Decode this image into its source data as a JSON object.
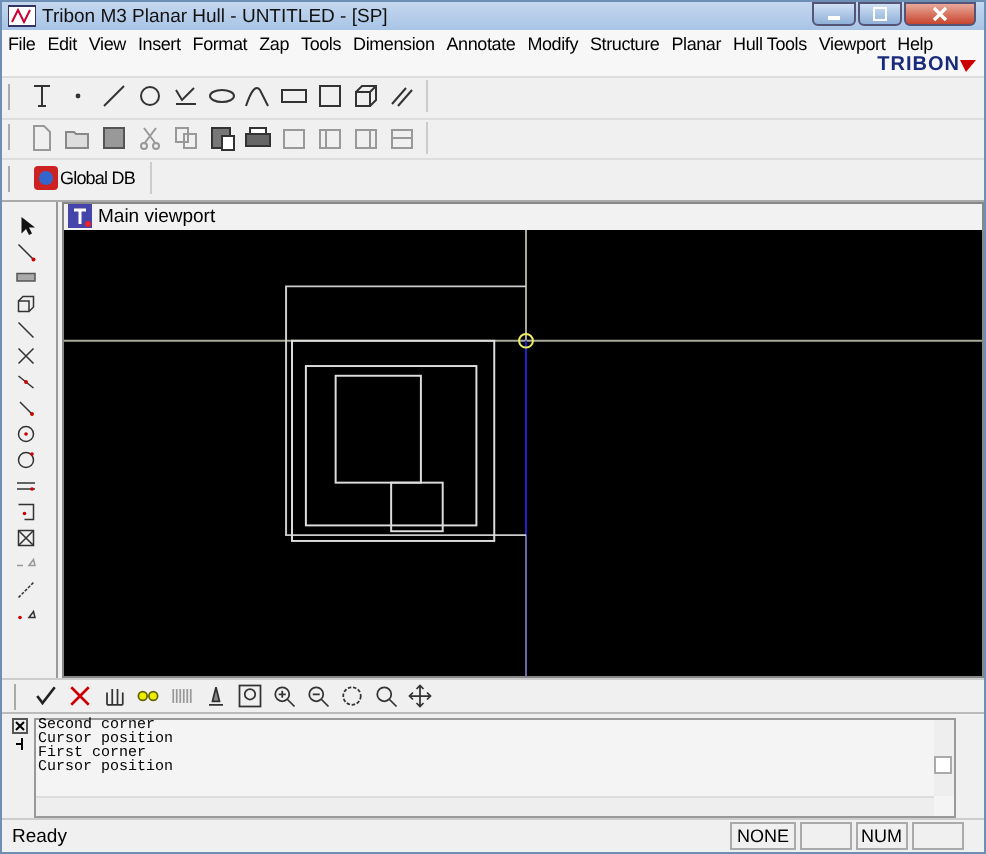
{
  "window": {
    "title": "Tribon M3 Planar Hull - UNTITLED - [SP]"
  },
  "menu": [
    "File",
    "Edit",
    "View",
    "Insert",
    "Format",
    "Zap",
    "Tools",
    "Dimension",
    "Annotate",
    "Modify",
    "Structure",
    "Planar",
    "Hull Tools",
    "Viewport",
    "Help"
  ],
  "logo": {
    "text": "TRIBON"
  },
  "db_bar": {
    "label": "Global DB"
  },
  "viewport": {
    "title": "Main viewport"
  },
  "output": {
    "lines": [
      "Second corner",
      "Cursor position",
      "First corner",
      "Cursor position"
    ]
  },
  "status_bar": {
    "message": "Ready",
    "panes": [
      "NONE",
      "NUM"
    ]
  }
}
